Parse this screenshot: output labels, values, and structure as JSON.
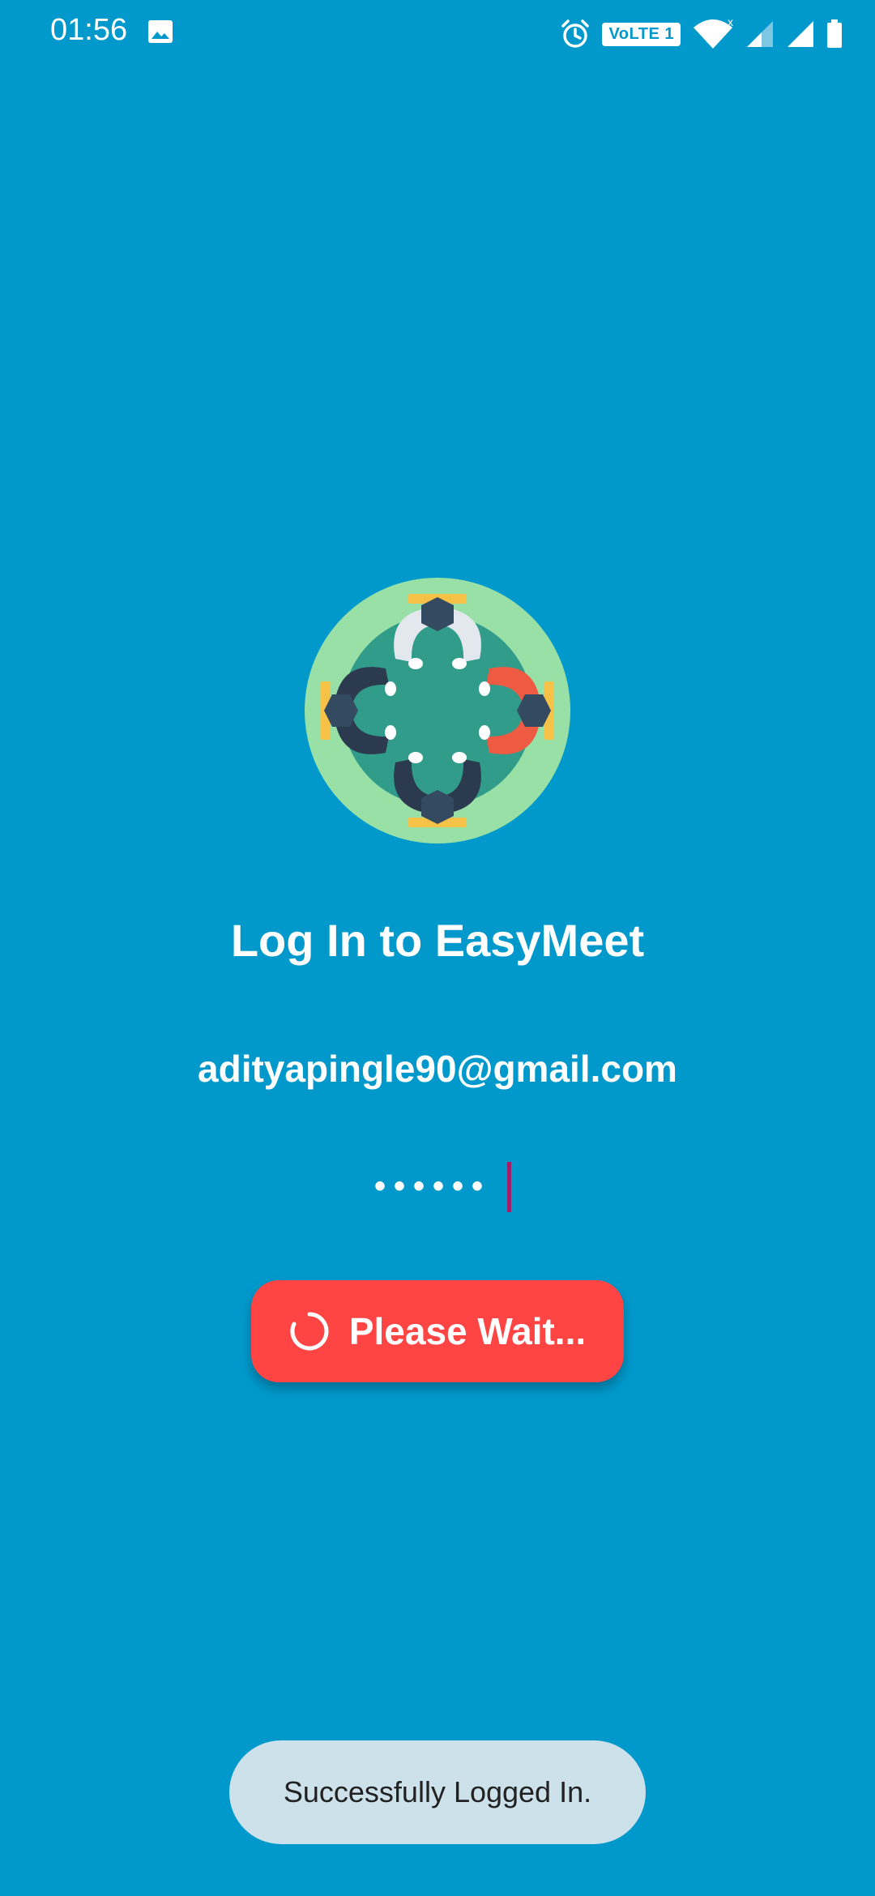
{
  "status_bar": {
    "time": "01:56",
    "volte_label": "VoLTE 1",
    "icons": [
      "image-icon",
      "alarm-icon",
      "volte-icon",
      "wifi-icon",
      "signal-icon",
      "signal-icon",
      "battery-icon"
    ]
  },
  "login": {
    "title": "Log In to EasyMeet",
    "email_value": "adityapingle90@gmail.com",
    "password_mask": "••••••",
    "button_label": "Please Wait..."
  },
  "toast": {
    "message": "Successfully Logged In."
  },
  "colors": {
    "background": "#0199cc",
    "button": "#ff4444",
    "toast": "#cce1ea",
    "cursor": "#a21e6a"
  }
}
